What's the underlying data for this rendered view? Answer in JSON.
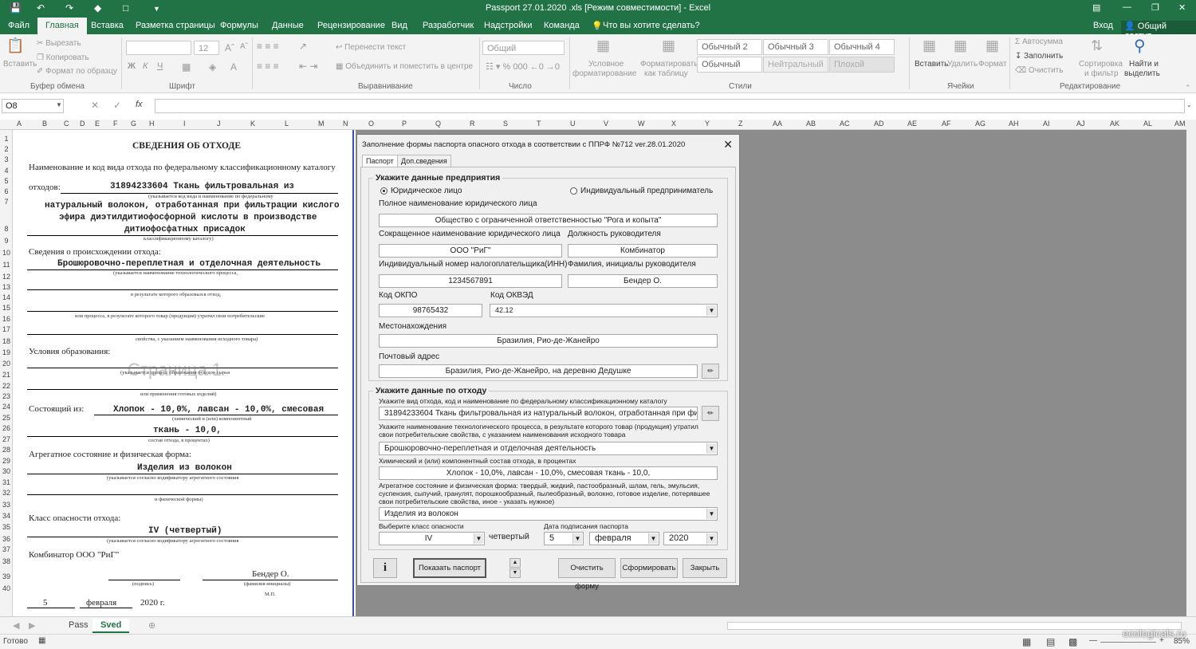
{
  "app": {
    "title": "Passport 27.01.2020 .xls  [Режим совместимости] - Excel",
    "signin": "Вход",
    "share": "Общий доступ"
  },
  "tabs": [
    "Файл",
    "Главная",
    "Вставка",
    "Разметка страницы",
    "Формулы",
    "Данные",
    "Рецензирование",
    "Вид",
    "Разработчик",
    "Надстройки",
    "Команда"
  ],
  "tell_me": "Что вы хотите сделать?",
  "ribbon": {
    "clipboard": {
      "paste": "Вставить",
      "cut": "Вырезать",
      "copy": "Копировать",
      "format_painter": "Формат по образцу",
      "group": "Буфер обмена"
    },
    "font": {
      "size": "12",
      "bold": "Ж",
      "italic": "К",
      "underline": "Ч",
      "group": "Шрифт"
    },
    "align": {
      "wrap": "Перенести текст",
      "merge": "Объединить и поместить в центре",
      "group": "Выравнивание"
    },
    "number": {
      "format": "Общий",
      "group": "Число"
    },
    "styles": {
      "cond1": "Условное",
      "cond2": "форматирование",
      "tbl1": "Форматировать",
      "tbl2": "как таблицу",
      "items": [
        "Обычный 2",
        "Обычный 3",
        "Обычный 4",
        "Обычный",
        "Нейтральный",
        "Плохой"
      ],
      "group": "Стили"
    },
    "cells": {
      "insert": "Вставить",
      "delete": "Удалить",
      "format": "Формат",
      "group": "Ячейки"
    },
    "edit": {
      "autosum": "Автосумма",
      "fill": "Заполнить",
      "clear": "Очистить",
      "sort1": "Сортировка",
      "sort2": "и фильтр",
      "find1": "Найти и",
      "find2": "выделить",
      "group": "Редактирование"
    }
  },
  "namebox": "O8",
  "columns": [
    "A",
    "B",
    "C",
    "D",
    "E",
    "F",
    "G",
    "H",
    "I",
    "J",
    "K",
    "L",
    "M",
    "N",
    "O",
    "P",
    "Q",
    "R",
    "S",
    "T",
    "U",
    "V",
    "W",
    "X",
    "Y",
    "Z",
    "AA",
    "AB",
    "AC",
    "AD",
    "AE",
    "AF",
    "AG",
    "AH",
    "AI",
    "AJ",
    "AK",
    "AL",
    "AM"
  ],
  "rows": [
    "1",
    "2",
    "3",
    "4",
    "5",
    "6",
    "7",
    "8",
    "9",
    "10",
    "11",
    "12",
    "13",
    "14",
    "15",
    "16",
    "17",
    "18",
    "19",
    "20",
    "21",
    "22",
    "23",
    "24",
    "25",
    "26",
    "27",
    "28",
    "29",
    "30",
    "31",
    "32",
    "33",
    "34",
    "35",
    "36",
    "37",
    "38",
    "39",
    "40"
  ],
  "sheet": {
    "title": "СВЕДЕНИЯ ОБ ОТХОДЕ",
    "r4": "Наименование и код вида отхода по федеральному классификационному каталогу",
    "r6_label": "отходов:",
    "r6_value": "31894233604 Ткань фильтровальная из",
    "r7_note": "(указывается код вида и наименование по федеральному",
    "r8_l1": "натуральный волокон, отработанная при фильтрации кислого",
    "r8_l2": "эфира диэтилдитиофосфорной кислоты в производстве",
    "r8_l3": "дитиофосфатных присадок",
    "r9_note": "классификационному каталогу)",
    "r10": "Сведения  о происхождении отхода:",
    "r11": "Брошюровочно-переплетная и отделочная деятельность",
    "r12_note": "(указывается наименование технологического процесса,",
    "r14_note": "в результате которого образовался отход,",
    "r16_note": "или процесса, в результате которого товар (продукция) утратил свои потребительские",
    "r18_note": "свойства, с указанием наименования исходного товара)",
    "r19": "Условия образования:",
    "r21_note": "(указывается процесс образования отходов сырья",
    "watermark": "Страница 1",
    "r23_note": "или применения готовых изделий)",
    "r24_label": "Состоящий из:",
    "r24_value": "Хлопок - 10,0%, лавсан - 10,0%, смесовая",
    "r25_note": "(химический и (или) компонентный",
    "r26": "ткань - 10,0,",
    "r27_note": "состав отхода, в процентах)",
    "r28": "Агрегатное состояние и физическая форма:",
    "r29": "Изделия из волокон",
    "r30_note": "(указывается согласно кодификатору агрегатного состояния",
    "r32_note": "и физической формы)",
    "r33": "Класс опасности отхода:",
    "r34": "IV (четвертый)",
    "r35_note": "(указывается согласно кодификатору агрегатного состояния",
    "r36": "Комбинатор ООО \"РиГ\"",
    "r37": "Бендер О.",
    "r38_sign": "(подпись)",
    "r38_name": "(фамилия инициалы)",
    "r38_mp": "М.П.",
    "r39_day": "5",
    "r39_month": "февраля",
    "r39_year": "2020 г."
  },
  "dialog": {
    "title": "Заполнение формы паспорта опасного отхода в соответствии с ППРФ №712 ver.28.01.2020",
    "tab1": "Паспорт",
    "tab2": "Доп.сведения",
    "org_section": "Укажите данные предприятия",
    "radio_legal": "Юридическое лицо",
    "radio_ip": "Индивидуальный предприниматель",
    "full_name_label": "Полное наименование юридического лица",
    "full_name": "Общество с ограниченной ответственностью \"Рога и копыта\"",
    "short_name_label": "Сокращенное наименование юридического лица",
    "short_name": "ООО \"РиГ\"",
    "position_label": "Должность руководителя",
    "position": "Комбинатор",
    "inn_label": "Индивидуальный номер налогоплательщика(ИНН)",
    "inn": "1234567891",
    "head_label": "Фамилия, инициалы руководителя",
    "head": "Бендер О.",
    "okpo_label": "Код ОКПО",
    "okpo": "98765432",
    "okved_label": "Код ОКВЭД",
    "okved": "42.12",
    "location_label": "Местонахождения",
    "location": "Бразилия, Рио-де-Жанейро",
    "postal_label": "Почтовый адрес",
    "postal": "Бразилия, Рио-де-Жанейро, на деревню Дедушке",
    "waste_section": "Укажите данные по отходу",
    "waste_type_label": "Укажите вид отхода, код и наименование по федеральному классификационному каталогу",
    "waste_type": "31894233604 Ткань фильтровальная из  натуральный волокон, отработанная при фил",
    "process_label1": "Укажите наименование технологического процесса, в результате которого товар (продукция) утратил",
    "process_label2": "свои потребительские свойства, с указанием наименования исходного товара",
    "process": "Брошюровочно-переплетная и отделочная деятельность",
    "composition_label": "Химический и (или) компонентный состав отхода, в процентах",
    "composition": "Хлопок - 10,0%, лавсан - 10,0%, смесовая  ткань - 10,0,",
    "state_label1": "Агрегатное состояние и физическая форма: твердый, жидкий,  пастообразный, шлам, гель, эмульсия,",
    "state_label2": "суспензия, сыпучий, гранулят, порошкообразный, пылеобразный, волокно, готовое изделие, потерявшее",
    "state_label3": "свои потребительские свойства, иное - указать нужное)",
    "state": "Изделия из волокон",
    "class_label": "Выберите класс опасности",
    "class": "IV",
    "class_text": "четвертый",
    "date_label": "Дата подписания паспорта",
    "day": "5",
    "month": "февраля",
    "year": "2020",
    "info_btn": "i",
    "show_btn": "Показать паспорт",
    "clear_btn": "Очистить форму",
    "make_btn": "Сформировать",
    "close_btn": "Закрыть"
  },
  "sheet_tabs": [
    "Pass",
    "Sved"
  ],
  "status": {
    "ready": "Готово",
    "zoom": "85%"
  },
  "watermark_site": "ecologicals.ru"
}
